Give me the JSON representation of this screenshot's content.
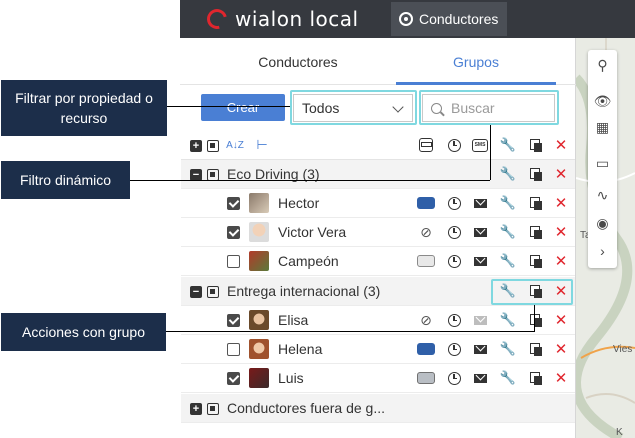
{
  "app": {
    "logo_text": "wialon local",
    "nav_label": "Conductores"
  },
  "tabs": [
    {
      "label": "Conductores",
      "active": false
    },
    {
      "label": "Grupos",
      "active": true
    }
  ],
  "toolbar": {
    "create_label": "Crear",
    "filter_value": "Todos",
    "search_placeholder": "Buscar"
  },
  "groups": [
    {
      "name": "Eco Driving (3)",
      "expanded": true,
      "members": [
        {
          "name": "Hector",
          "checked": true,
          "vehicle": "blue-car"
        },
        {
          "name": "Victor Vera",
          "checked": true,
          "vehicle": "unbound"
        },
        {
          "name": "Campeón",
          "checked": false,
          "vehicle": "white-car"
        }
      ]
    },
    {
      "name": "Entrega internacional (3)",
      "expanded": true,
      "members": [
        {
          "name": "Elisa",
          "checked": true,
          "vehicle": "unbound"
        },
        {
          "name": "Helena",
          "checked": false,
          "vehicle": "blue-car"
        },
        {
          "name": "Luis",
          "checked": true,
          "vehicle": "grey-van"
        }
      ]
    },
    {
      "name": "Conductores fuera de g...",
      "expanded": false,
      "members": []
    }
  ],
  "callouts": {
    "filter": "Filtrar por propiedad o recurso",
    "dynamic": "Filtro dinámico",
    "actions": "Acciones con grupo"
  },
  "header_icons": {
    "sort": "A↓Z",
    "sms": "SMS"
  },
  "map": {
    "label_viesca": "Vies",
    "label_ta": "Ta",
    "label_k": "K"
  },
  "colors": {
    "accent": "#4a7fd4",
    "topbar": "#36393f",
    "delete": "#e0262e",
    "callout_bg": "#1c2e4a",
    "highlight": "#7fd8e0"
  }
}
